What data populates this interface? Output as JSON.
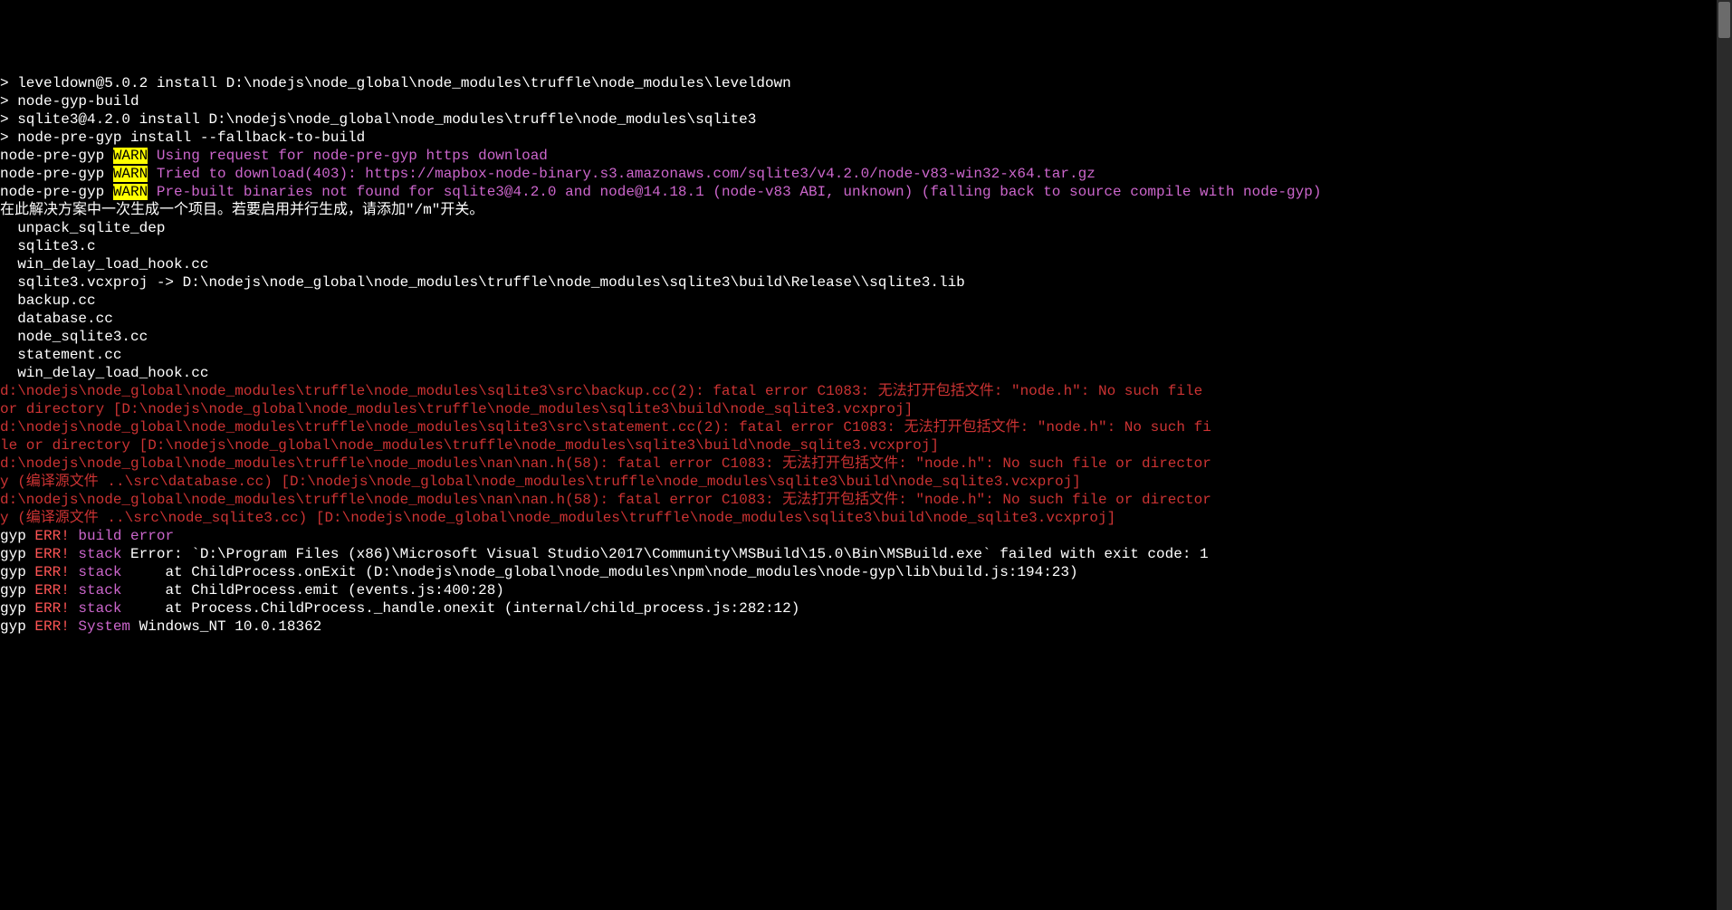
{
  "lines": [
    {
      "segments": [
        {
          "cls": "white",
          "text": "> leveldown@5.0.2 install D:\\nodejs\\node_global\\node_modules\\truffle\\node_modules\\leveldown"
        }
      ]
    },
    {
      "segments": [
        {
          "cls": "white",
          "text": "> node-gyp-build"
        }
      ]
    },
    {
      "segments": [
        {
          "cls": "white",
          "text": ""
        }
      ]
    },
    {
      "segments": [
        {
          "cls": "white",
          "text": ""
        }
      ]
    },
    {
      "segments": [
        {
          "cls": "white",
          "text": "> sqlite3@4.2.0 install D:\\nodejs\\node_global\\node_modules\\truffle\\node_modules\\sqlite3"
        }
      ]
    },
    {
      "segments": [
        {
          "cls": "white",
          "text": "> node-pre-gyp install --fallback-to-build"
        }
      ]
    },
    {
      "segments": [
        {
          "cls": "white",
          "text": ""
        }
      ]
    },
    {
      "segments": [
        {
          "cls": "white",
          "text": "node-pre-gyp "
        },
        {
          "cls": "yellow-bg",
          "text": "WARN"
        },
        {
          "cls": "purple",
          "text": " Using request for node-pre-gyp https download"
        }
      ]
    },
    {
      "segments": [
        {
          "cls": "white",
          "text": "node-pre-gyp "
        },
        {
          "cls": "yellow-bg",
          "text": "WARN"
        },
        {
          "cls": "purple",
          "text": " Tried to download(403): https://mapbox-node-binary.s3.amazonaws.com/sqlite3/v4.2.0/node-v83-win32-x64.tar.gz"
        }
      ]
    },
    {
      "segments": [
        {
          "cls": "white",
          "text": "node-pre-gyp "
        },
        {
          "cls": "yellow-bg",
          "text": "WARN"
        },
        {
          "cls": "purple",
          "text": " Pre-built binaries not found for sqlite3@4.2.0 and node@14.18.1 (node-v83 ABI, unknown) (falling back to source compile with node-gyp)"
        }
      ]
    },
    {
      "segments": [
        {
          "cls": "white",
          "text": "在此解决方案中一次生成一个项目。若要启用并行生成，请添加\"/m\"开关。"
        }
      ]
    },
    {
      "segments": [
        {
          "cls": "white",
          "text": "  unpack_sqlite_dep"
        }
      ]
    },
    {
      "segments": [
        {
          "cls": "white",
          "text": "  sqlite3.c"
        }
      ]
    },
    {
      "segments": [
        {
          "cls": "white",
          "text": "  win_delay_load_hook.cc"
        }
      ]
    },
    {
      "segments": [
        {
          "cls": "white",
          "text": "  sqlite3.vcxproj -> D:\\nodejs\\node_global\\node_modules\\truffle\\node_modules\\sqlite3\\build\\Release\\\\sqlite3.lib"
        }
      ]
    },
    {
      "segments": [
        {
          "cls": "white",
          "text": "  backup.cc"
        }
      ]
    },
    {
      "segments": [
        {
          "cls": "white",
          "text": "  database.cc"
        }
      ]
    },
    {
      "segments": [
        {
          "cls": "white",
          "text": "  node_sqlite3.cc"
        }
      ]
    },
    {
      "segments": [
        {
          "cls": "white",
          "text": "  statement.cc"
        }
      ]
    },
    {
      "segments": [
        {
          "cls": "white",
          "text": "  win_delay_load_hook.cc"
        }
      ]
    },
    {
      "segments": [
        {
          "cls": "darkred",
          "text": "d:\\nodejs\\node_global\\node_modules\\truffle\\node_modules\\sqlite3\\src\\backup.cc(2): fatal error C1083: 无法打开包括文件: \"node.h\": No such file"
        }
      ]
    },
    {
      "segments": [
        {
          "cls": "darkred",
          "text": "or directory [D:\\nodejs\\node_global\\node_modules\\truffle\\node_modules\\sqlite3\\build\\node_sqlite3.vcxproj]"
        }
      ]
    },
    {
      "segments": [
        {
          "cls": "darkred",
          "text": "d:\\nodejs\\node_global\\node_modules\\truffle\\node_modules\\sqlite3\\src\\statement.cc(2): fatal error C1083: 无法打开包括文件: \"node.h\": No such fi"
        }
      ]
    },
    {
      "segments": [
        {
          "cls": "darkred",
          "text": "le or directory [D:\\nodejs\\node_global\\node_modules\\truffle\\node_modules\\sqlite3\\build\\node_sqlite3.vcxproj]"
        }
      ]
    },
    {
      "segments": [
        {
          "cls": "darkred",
          "text": "d:\\nodejs\\node_global\\node_modules\\truffle\\node_modules\\nan\\nan.h(58): fatal error C1083: 无法打开包括文件: \"node.h\": No such file or director"
        }
      ]
    },
    {
      "segments": [
        {
          "cls": "darkred",
          "text": "y (编译源文件 ..\\src\\database.cc) [D:\\nodejs\\node_global\\node_modules\\truffle\\node_modules\\sqlite3\\build\\node_sqlite3.vcxproj]"
        }
      ]
    },
    {
      "segments": [
        {
          "cls": "darkred",
          "text": "d:\\nodejs\\node_global\\node_modules\\truffle\\node_modules\\nan\\nan.h(58): fatal error C1083: 无法打开包括文件: \"node.h\": No such file or director"
        }
      ]
    },
    {
      "segments": [
        {
          "cls": "darkred",
          "text": "y (编译源文件 ..\\src\\node_sqlite3.cc) [D:\\nodejs\\node_global\\node_modules\\truffle\\node_modules\\sqlite3\\build\\node_sqlite3.vcxproj]"
        }
      ]
    },
    {
      "segments": [
        {
          "cls": "white",
          "text": "gyp "
        },
        {
          "cls": "red",
          "text": "ERR! "
        },
        {
          "cls": "purple",
          "text": "build error"
        }
      ]
    },
    {
      "segments": [
        {
          "cls": "white",
          "text": "gyp "
        },
        {
          "cls": "red",
          "text": "ERR! "
        },
        {
          "cls": "purple",
          "text": "stack "
        },
        {
          "cls": "white",
          "text": "Error: `D:\\Program Files (x86)\\Microsoft Visual Studio\\2017\\Community\\MSBuild\\15.0\\Bin\\MSBuild.exe` failed with exit code: 1"
        }
      ]
    },
    {
      "segments": [
        {
          "cls": "white",
          "text": "gyp "
        },
        {
          "cls": "red",
          "text": "ERR! "
        },
        {
          "cls": "purple",
          "text": "stack "
        },
        {
          "cls": "white",
          "text": "    at ChildProcess.onExit (D:\\nodejs\\node_global\\node_modules\\npm\\node_modules\\node-gyp\\lib\\build.js:194:23)"
        }
      ]
    },
    {
      "segments": [
        {
          "cls": "white",
          "text": "gyp "
        },
        {
          "cls": "red",
          "text": "ERR! "
        },
        {
          "cls": "purple",
          "text": "stack "
        },
        {
          "cls": "white",
          "text": "    at ChildProcess.emit (events.js:400:28)"
        }
      ]
    },
    {
      "segments": [
        {
          "cls": "white",
          "text": "gyp "
        },
        {
          "cls": "red",
          "text": "ERR! "
        },
        {
          "cls": "purple",
          "text": "stack "
        },
        {
          "cls": "white",
          "text": "    at Process.ChildProcess._handle.onexit (internal/child_process.js:282:12)"
        }
      ]
    },
    {
      "segments": [
        {
          "cls": "white",
          "text": "gyp "
        },
        {
          "cls": "red",
          "text": "ERR! "
        },
        {
          "cls": "purple",
          "text": "System "
        },
        {
          "cls": "white",
          "text": "Windows_NT 10.0.18362"
        }
      ]
    }
  ]
}
